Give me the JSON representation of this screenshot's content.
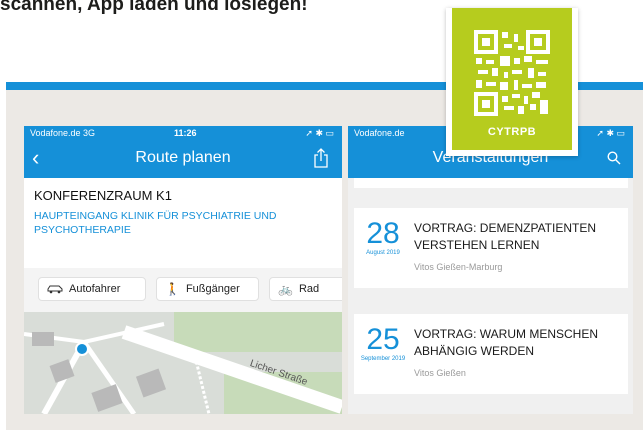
{
  "headline": "scannen, App laden und loslegen!",
  "qr": {
    "code": "CYTRPB"
  },
  "left_phone": {
    "status": {
      "carrier": "Vodafone.de  3G",
      "time": "11:26"
    },
    "nav": {
      "title": "Route planen"
    },
    "room": {
      "title": "KONFERENZRAUM K1",
      "subtitle": "HAUPTEINGANG KLINIK FÜR PSYCHIATRIE UND PSYCHOTHERAPIE"
    },
    "transport": [
      {
        "label": "Autofahrer",
        "icon": "car-icon"
      },
      {
        "label": "Fußgänger",
        "icon": "pedestrian-icon"
      },
      {
        "label": "Rad",
        "icon": "bicycle-icon"
      }
    ],
    "map": {
      "street": "Licher Straße"
    }
  },
  "right_phone": {
    "status": {
      "carrier": "Vodafone.de"
    },
    "nav": {
      "title": "Veranstaltungen"
    },
    "events": [
      {
        "day": "28",
        "month": "August 2019",
        "title": "VORTRAG: DEMENZPATIENTEN VERSTEHEN LERNEN",
        "location": "Vitos Gießen-Marburg"
      },
      {
        "day": "25",
        "month": "September 2019",
        "title": "VORTRAG: WARUM MENSCHEN ABHÄNGIG WERDEN",
        "location": "Vitos Gießen"
      }
    ]
  },
  "colors": {
    "brand_blue": "#1590d8",
    "qr_green": "#b6cc1e",
    "panel_bg": "#ece9e5"
  }
}
